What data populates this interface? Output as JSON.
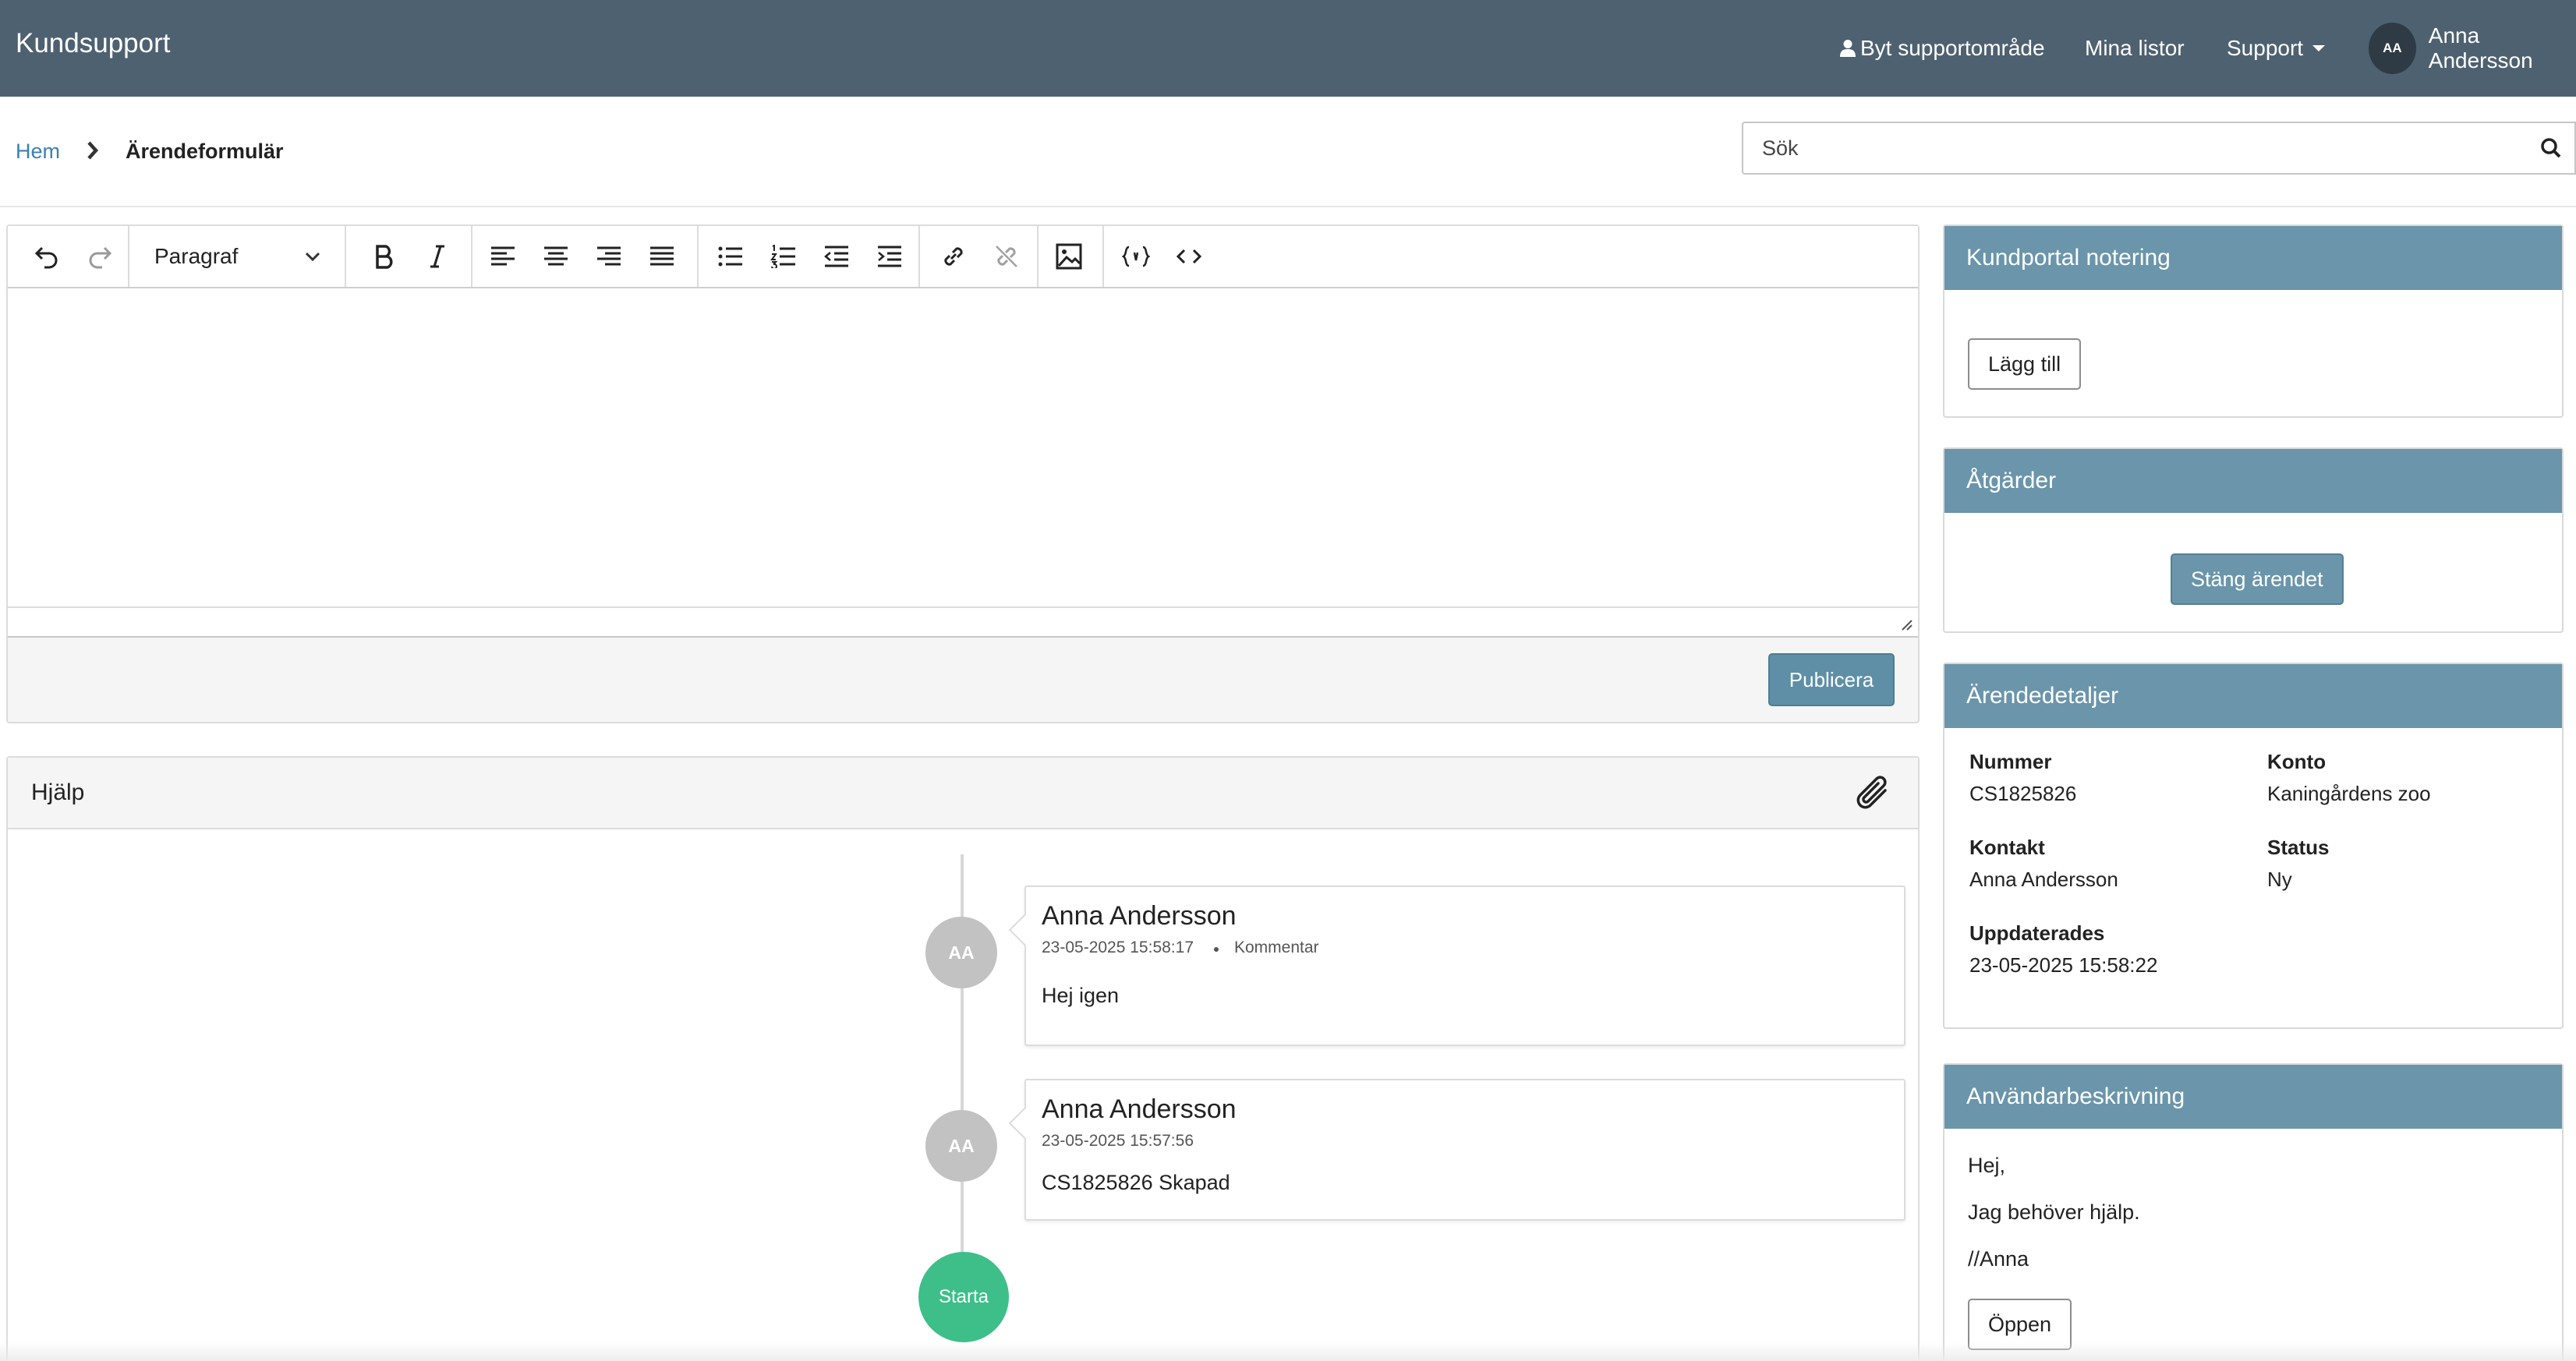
{
  "app": {
    "title": "Kundsupport"
  },
  "nav": {
    "switch_area": "Byt supportområde",
    "my_lists": "Mina listor",
    "support": "Support",
    "user_initials": "AA",
    "user_name": "Anna Andersson"
  },
  "breadcrumb": {
    "home": "Hem",
    "current": "Ärendeformulär"
  },
  "search": {
    "placeholder": "Sök",
    "value": ""
  },
  "editor": {
    "format_select": "Paragraf",
    "content": "",
    "publish_label": "Publicera",
    "toolbar_icons": [
      "undo-icon",
      "redo-icon",
      "bold-icon",
      "italic-icon",
      "align-left-icon",
      "align-center-icon",
      "align-right-icon",
      "align-justify-icon",
      "bullet-list-icon",
      "numbered-list-icon",
      "outdent-icon",
      "indent-icon",
      "link-icon",
      "unlink-icon",
      "image-icon",
      "code-sample-icon",
      "source-code-icon"
    ]
  },
  "help": {
    "title": "Hjälp",
    "entries": [
      {
        "initials": "AA",
        "author": "Anna Andersson",
        "time": "23-05-2025 15:58:17",
        "kind": "Kommentar",
        "body": "Hej igen"
      },
      {
        "initials": "AA",
        "author": "Anna Andersson",
        "time": "23-05-2025 15:57:56",
        "kind": "",
        "body": "CS1825826 Skapad"
      }
    ],
    "start_label": "Starta"
  },
  "panels": {
    "portal_note": {
      "title": "Kundportal notering",
      "add_label": "Lägg till"
    },
    "actions": {
      "title": "Åtgärder",
      "close_label": "Stäng ärendet"
    },
    "details": {
      "title": "Ärendedetaljer",
      "number_label": "Nummer",
      "number": "CS1825826",
      "account_label": "Konto",
      "account": "Kaningårdens zoo",
      "contact_label": "Kontakt",
      "contact": "Anna Andersson",
      "status_label": "Status",
      "status": "Ny",
      "updated_label": "Uppdaterades",
      "updated": "23-05-2025 15:58:22"
    },
    "user_description": {
      "title": "Användarbeskrivning",
      "lines": [
        "Hej,",
        "Jag behöver hjälp.",
        "//Anna"
      ],
      "open_label": "Öppen"
    }
  },
  "colors": {
    "topbar": "#4e6170",
    "panel_header": "#6a95aa",
    "start": "#3ebf8a",
    "link": "#3a80b4"
  }
}
